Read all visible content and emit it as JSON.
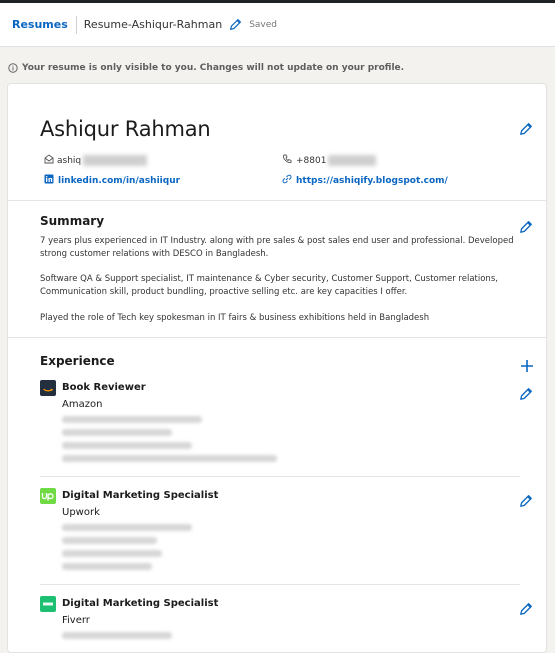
{
  "topbar": {
    "resumes_label": "Resumes",
    "resume_name": "Resume-Ashiqur-Rahman",
    "saved_label": "Saved"
  },
  "notice": {
    "text": "Your resume is only visible to you. Changes will not update on your profile."
  },
  "profile": {
    "name": "Ashiqur Rahman",
    "email_prefix": "ashiq",
    "phone_prefix": "+8801",
    "linkedin": "linkedin.com/in/ashiiqur",
    "website": "https://ashiqify.blogspot.com/"
  },
  "summary": {
    "title": "Summary",
    "para1": "7 years plus experienced in IT Industry. along with pre sales & post sales end user and professional. Developed strong customer relations with DESCO in Bangladesh.",
    "para2": "Software QA & Support specialist, IT maintenance & Cyber security, Customer Support, Customer relations, Communication skill, product bundling, proactive selling etc. are key capacities I offer.",
    "para3": "Played the role of Tech key spokesman in IT fairs & business exhibitions held in Bangladesh"
  },
  "experience": {
    "title": "Experience",
    "items": [
      {
        "title": "Book Reviewer",
        "company": "Amazon",
        "logo": "amazon-logo",
        "logo_color": "#232f3e"
      },
      {
        "title": "Digital Marketing Specialist",
        "company": "Upwork",
        "logo": "upwork-logo",
        "logo_color": "#6fda44"
      },
      {
        "title": "Digital Marketing Specialist",
        "company": "Fiverr",
        "logo": "fiverr-logo",
        "logo_color": "#1dbf73"
      }
    ]
  },
  "colors": {
    "accent": "#0a66c2",
    "background": "#f3f2ef"
  }
}
